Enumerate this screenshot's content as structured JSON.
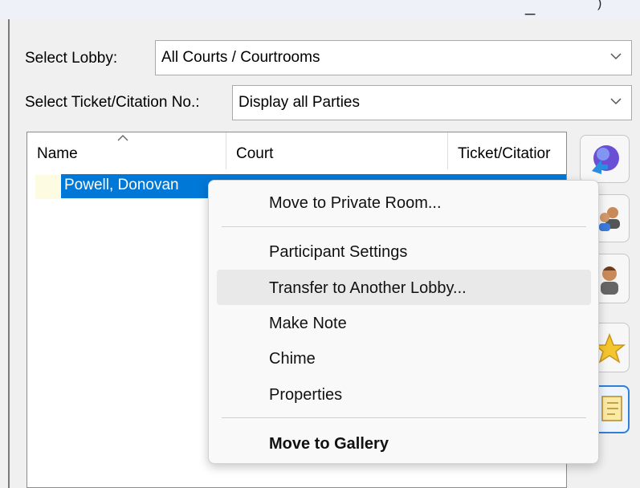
{
  "filters": {
    "lobby_label": "Select Lobby:",
    "lobby_value": "All Courts / Courtrooms",
    "ticket_label": "Select Ticket/Citation No.:",
    "ticket_value": "Display all Parties"
  },
  "table": {
    "columns": [
      "Name",
      "Court",
      "Ticket/Citatior"
    ],
    "sort_indicator": "^",
    "rows": [
      {
        "name": "Powell, Donovan"
      }
    ]
  },
  "side_icons": [
    "globe-arrow-icon",
    "transfer-users-icon",
    "participant-icon",
    "star-icon",
    "note-icon"
  ],
  "context_menu": {
    "items": [
      {
        "label": "Move to Private Room...",
        "bold": false
      },
      {
        "label": "Participant Settings",
        "bold": false
      },
      {
        "label": "Transfer to Another Lobby...",
        "bold": false,
        "hovered": true
      },
      {
        "label": "Make Note",
        "bold": false
      },
      {
        "label": "Chime",
        "bold": false
      },
      {
        "label": "Properties",
        "bold": false
      },
      {
        "label": "Move to Gallery",
        "bold": true
      }
    ]
  },
  "colors": {
    "selection": "#0078d7",
    "accent_border": "#2f7fd6",
    "menu_hover": "#e9e9e9"
  }
}
